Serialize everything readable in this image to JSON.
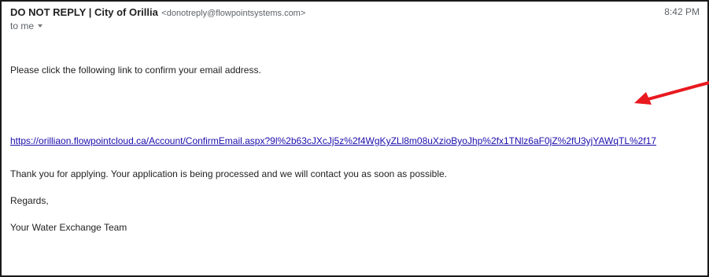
{
  "email": {
    "sender_name": "DO NOT REPLY | City of Orillia",
    "sender_email": "<donotreply@flowpointsystems.com>",
    "time": "8:42 PM",
    "recipient": "to me",
    "body": {
      "instruction": "Please click the following link to confirm your email address.",
      "link": "https://orilliaon.flowpointcloud.ca/Account/ConfirmEmail.aspx?9l%2b63cJXcJj5z%2f4WgKyZLl8m08uXzioByoJhp%2fx1TNlz6aF0jZ%2fU3yjYAWqTL%2f17",
      "thanks": "Thank you for applying. Your application is being processed and we will contact you as soon as possible.",
      "regards": "Regards,",
      "signature": "Your Water Exchange Team"
    }
  },
  "annotation": {
    "arrow_color": "#e8191f"
  },
  "icons": {
    "recipient_dropdown": "caret-down-icon",
    "annotation": "red-arrow-icon"
  }
}
